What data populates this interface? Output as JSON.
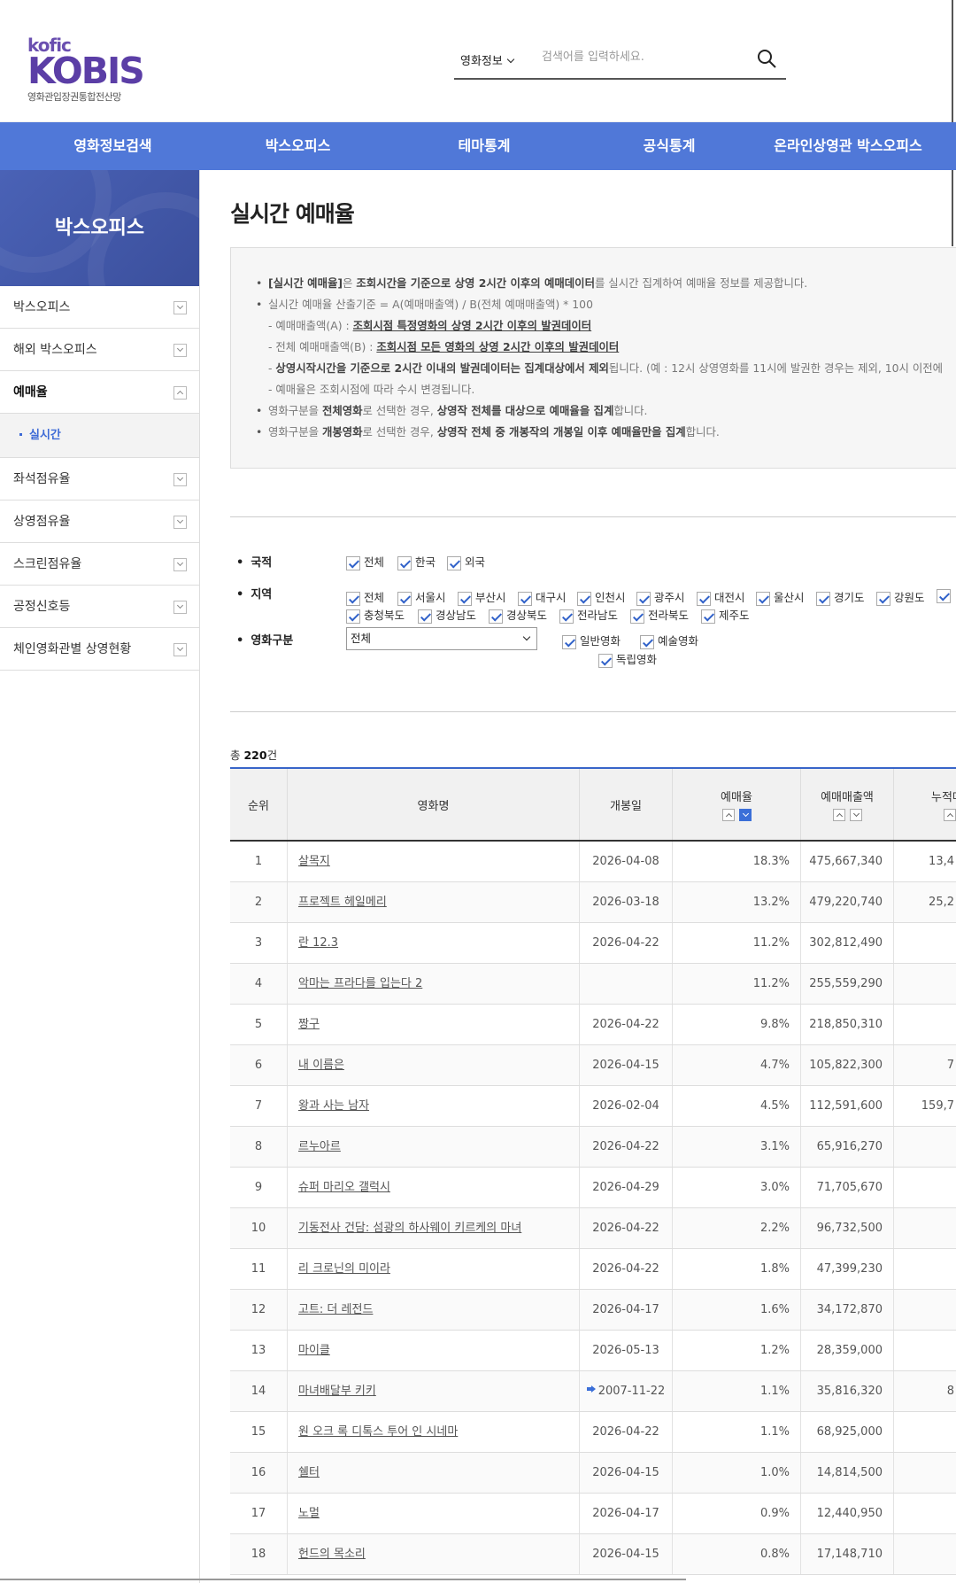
{
  "header": {
    "logo_top": "kofic",
    "logo_main": "KOBIS",
    "logo_sub": "영화관입장권통합전산망",
    "search_category": "영화정보",
    "search_placeholder": "검색어를 입력하세요."
  },
  "nav": [
    "영화정보검색",
    "박스오피스",
    "테마통계",
    "공식통계",
    "온라인상영관 박스오피스"
  ],
  "sidebar": {
    "title": "박스오피스",
    "items": [
      "박스오피스",
      "해외 박스오피스",
      "예매율",
      "좌석점유율",
      "상영점유율",
      "스크린점유율",
      "공정신호등",
      "체인영화관별 상영현황"
    ],
    "sub_item": "실시간"
  },
  "page_title": "실시간 예매율",
  "info": {
    "l1a": "[실시간 예매율]",
    "l1b": "은 ",
    "l1c": "조회시간을 기준으로 상영 2시간 이후의 예매데이터",
    "l1d": "를 실시간 집계하여 예매율 정보를 제공합니다.",
    "l2": "실시간 예매율 산출기준 = A(예매매출액) / B(전체 예매매출액) * 100",
    "l3a": "- 예매매출액(A) : ",
    "l3b": "조회시점 특정영화의 상영 2시간 이후의 발권데이터",
    "l4a": "- 전체 예매매출액(B) : ",
    "l4b": "조회시점 모든 영화의 상영 2시간 이후의 발권데이터",
    "l5a": "- ",
    "l5b": "상영시작시간을 기준으로 2시간 이내의 발권데이터는 집계대상에서 제외",
    "l5c": "됩니다. (예 : 12시 상영영화를 11시에 발권한 경우는 제외, 10시 이전에",
    "l6": "- 예매율은 조회시점에 따라 수시 변경됩니다.",
    "l7a": "영화구분을 ",
    "l7b": "전체영화",
    "l7c": "로 선택한 경우, ",
    "l7d": "상영작 전체를 대상으로 예매율을 집계",
    "l7e": "합니다.",
    "l8a": "영화구분을 ",
    "l8b": "개봉영화",
    "l8c": "로 선택한 경우, ",
    "l8d": "상영작 전체 중 개봉작의 개봉일 이후 예매율만을 집계",
    "l8e": "합니다."
  },
  "filter": {
    "nation_label": "국적",
    "nation": [
      "전체",
      "한국",
      "외국"
    ],
    "region_label": "지역",
    "region_row1": [
      "전체",
      "서울시",
      "부산시",
      "대구시",
      "인천시",
      "광주시",
      "대전시",
      "울산시",
      "경기도",
      "강원도"
    ],
    "region_row2": [
      "충청북도",
      "경상남도",
      "경상북도",
      "전라남도",
      "전라북도",
      "제주도"
    ],
    "movie_type_label": "영화구분",
    "movie_type_select": "전체",
    "movie_types": [
      "일반영화",
      "예술영화",
      "독립영화"
    ]
  },
  "total": {
    "prefix": "총 ",
    "count": "220",
    "suffix": "건"
  },
  "table": {
    "headers": [
      "순위",
      "영화명",
      "개봉일",
      "예매율",
      "예매매출액",
      "누적매"
    ],
    "rows": [
      {
        "rank": "1",
        "title": "살목지",
        "date": "2026-04-08",
        "rate": "18.3%",
        "sales": "475,667,340",
        "cum": "13,4"
      },
      {
        "rank": "2",
        "title": "프로젝트 헤일메리",
        "date": "2026-03-18",
        "rate": "13.2%",
        "sales": "479,220,740",
        "cum": "25,2"
      },
      {
        "rank": "3",
        "title": "란 12.3",
        "date": "2026-04-22",
        "rate": "11.2%",
        "sales": "302,812,490",
        "cum": ""
      },
      {
        "rank": "4",
        "title": "악마는 프라다를 입는다 2",
        "date": "",
        "rate": "11.2%",
        "sales": "255,559,290",
        "cum": ""
      },
      {
        "rank": "5",
        "title": "짱구",
        "date": "2026-04-22",
        "rate": "9.8%",
        "sales": "218,850,310",
        "cum": ""
      },
      {
        "rank": "6",
        "title": "내 이름은",
        "date": "2026-04-15",
        "rate": "4.7%",
        "sales": "105,822,300",
        "cum": "7"
      },
      {
        "rank": "7",
        "title": "왕과 사는 남자",
        "date": "2026-02-04",
        "rate": "4.5%",
        "sales": "112,591,600",
        "cum": "159,7"
      },
      {
        "rank": "8",
        "title": "르누아르",
        "date": "2026-04-22",
        "rate": "3.1%",
        "sales": "65,916,270",
        "cum": ""
      },
      {
        "rank": "9",
        "title": "슈퍼 마리오 갤럭시",
        "date": "2026-04-29",
        "rate": "3.0%",
        "sales": "71,705,670",
        "cum": ""
      },
      {
        "rank": "10",
        "title": "기동전사 건담: 섬광의 하사웨이 키르케의 마녀",
        "date": "2026-04-22",
        "rate": "2.2%",
        "sales": "96,732,500",
        "cum": ""
      },
      {
        "rank": "11",
        "title": "리 크로닌의 미이라",
        "date": "2026-04-22",
        "rate": "1.8%",
        "sales": "47,399,230",
        "cum": ""
      },
      {
        "rank": "12",
        "title": "고트: 더 레전드",
        "date": "2026-04-17",
        "rate": "1.6%",
        "sales": "34,172,870",
        "cum": ""
      },
      {
        "rank": "13",
        "title": "마이클",
        "date": "2026-05-13",
        "rate": "1.2%",
        "sales": "28,359,000",
        "cum": ""
      },
      {
        "rank": "14",
        "title": "마녀배달부 키키",
        "date": "2007-11-22",
        "rate": "1.1%",
        "sales": "35,816,320",
        "cum": "8",
        "rerelease": true
      },
      {
        "rank": "15",
        "title": "원 오크 록 디톡스 투어 인 시네마",
        "date": "2026-04-22",
        "rate": "1.1%",
        "sales": "68,925,000",
        "cum": ""
      },
      {
        "rank": "16",
        "title": "쉘터",
        "date": "2026-04-15",
        "rate": "1.0%",
        "sales": "14,814,500",
        "cum": ""
      },
      {
        "rank": "17",
        "title": "노멀",
        "date": "2026-04-17",
        "rate": "0.9%",
        "sales": "12,440,950",
        "cum": ""
      },
      {
        "rank": "18",
        "title": "헌드의 목소리",
        "date": "2026-04-15",
        "rate": "0.8%",
        "sales": "17,148,710",
        "cum": ""
      }
    ]
  }
}
